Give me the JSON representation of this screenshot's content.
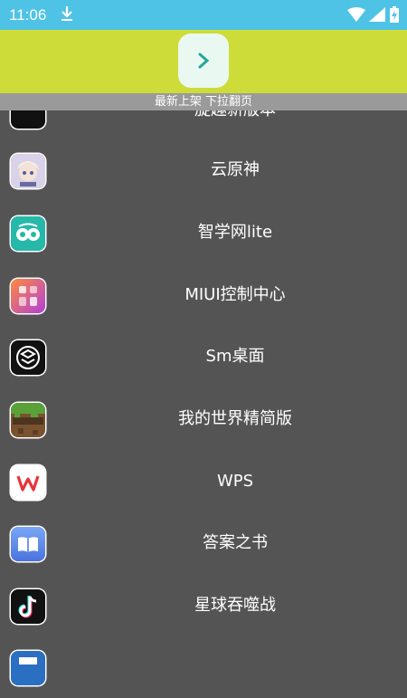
{
  "status": {
    "time": "11:06"
  },
  "banner": {
    "subtitle": "最新上架 下拉翻页"
  },
  "apps": [
    {
      "name": "旋趣新版本",
      "icon": "app-icon-partial"
    },
    {
      "name": "云原神",
      "icon": "genshin-icon"
    },
    {
      "name": "智学网lite",
      "icon": "owl-icon"
    },
    {
      "name": "MIUI控制中心",
      "icon": "control-center-icon"
    },
    {
      "name": "Sm桌面",
      "icon": "sm-launcher-icon"
    },
    {
      "name": "我的世界精简版",
      "icon": "minecraft-icon"
    },
    {
      "name": "WPS",
      "icon": "wps-icon"
    },
    {
      "name": "答案之书",
      "icon": "book-icon"
    },
    {
      "name": "星球吞噬战",
      "icon": "tiktok-icon"
    },
    {
      "name": "",
      "icon": "calculator-icon"
    }
  ]
}
